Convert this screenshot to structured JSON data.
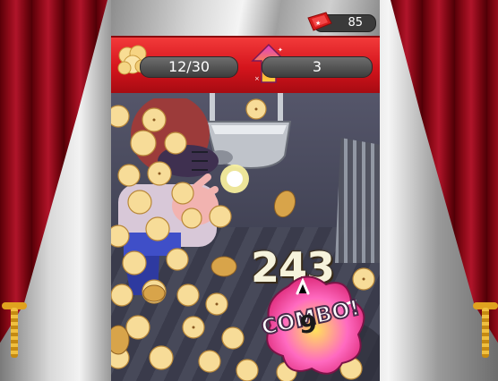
{
  "hud": {
    "ticket_score": "85",
    "popcorn_progress": "12/30",
    "combo_level": "3"
  },
  "floating_score": "243",
  "combo": {
    "label": "COMBO!",
    "count": "9"
  },
  "colors": {
    "curtain_red": "#8e0a18",
    "hud_red": "#d4141c",
    "combo_pink": "#e0308a",
    "combo_yellow": "#ffd23a",
    "popcorn": "#f6dd9a",
    "kernel": "#d79a3a"
  },
  "icons": {
    "ticket": "ticket-icon",
    "popcorn": "popcorn-icon",
    "level_up": "arrow-up-icon",
    "combo": "combo-burst-icon"
  }
}
